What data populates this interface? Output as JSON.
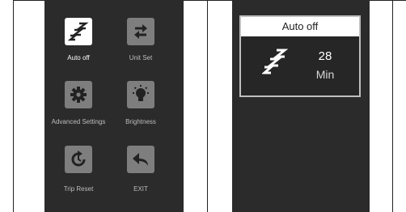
{
  "menu": {
    "items": [
      {
        "label": "Auto off",
        "icon": "sleep-zz-icon",
        "selected": true
      },
      {
        "label": "Unit Set",
        "icon": "swap-arrows-icon",
        "selected": false
      },
      {
        "label": "Advanced Settings",
        "icon": "gear-icon",
        "selected": false
      },
      {
        "label": "Brightness",
        "icon": "bulb-icon",
        "selected": false
      },
      {
        "label": "Trip Reset",
        "icon": "reset-icon",
        "selected": false
      },
      {
        "label": "EXIT",
        "icon": "back-arrow-icon",
        "selected": false
      }
    ]
  },
  "dialog": {
    "title": "Auto off",
    "value": "28",
    "unit": "Min",
    "icon": "sleep-zz-icon"
  },
  "colors": {
    "panel_bg": "#2b2b2b",
    "icon_bg": "#7e7e7e",
    "selected_icon_bg": "#ffffff"
  }
}
